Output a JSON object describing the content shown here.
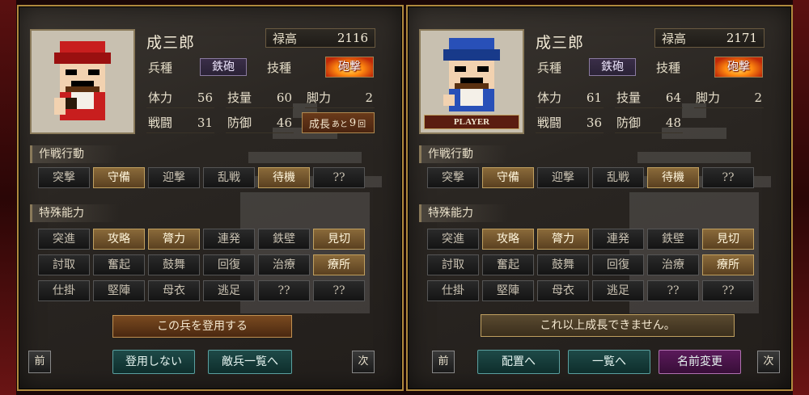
{
  "screens": [
    {
      "name": "成三郎",
      "income_label": "禄高",
      "income": "2116",
      "troop_label": "兵種",
      "troop": "鉄砲",
      "skill_label": "技種",
      "skill": "砲撃",
      "stats": [
        {
          "k": "体力",
          "v": "56"
        },
        {
          "k": "技量",
          "v": "60"
        },
        {
          "k": "脚力",
          "v": "2"
        },
        {
          "k": "戦闘",
          "v": "31"
        },
        {
          "k": "防御",
          "v": "46"
        }
      ],
      "growth": {
        "a": "成長",
        "b": "あと",
        "c": "9",
        "d": "回"
      },
      "player_tag": "",
      "tactics_title": "作戦行動",
      "tactics": [
        {
          "t": "突撃",
          "on": false
        },
        {
          "t": "守備",
          "on": true
        },
        {
          "t": "迎撃",
          "on": false
        },
        {
          "t": "乱戦",
          "on": false
        },
        {
          "t": "待機",
          "on": true
        },
        {
          "t": "??",
          "on": false
        }
      ],
      "special_title": "特殊能力",
      "special": [
        {
          "t": "突進",
          "on": false
        },
        {
          "t": "攻略",
          "on": true
        },
        {
          "t": "膂力",
          "on": true
        },
        {
          "t": "連発",
          "on": false
        },
        {
          "t": "鉄壁",
          "on": false
        },
        {
          "t": "見切",
          "on": true
        },
        {
          "t": "討取",
          "on": false
        },
        {
          "t": "奮起",
          "on": false
        },
        {
          "t": "鼓舞",
          "on": false
        },
        {
          "t": "回復",
          "on": false
        },
        {
          "t": "治療",
          "on": false
        },
        {
          "t": "療所",
          "on": true
        },
        {
          "t": "仕掛",
          "on": false
        },
        {
          "t": "堅陣",
          "on": false
        },
        {
          "t": "母衣",
          "on": false
        },
        {
          "t": "逃足",
          "on": false
        },
        {
          "t": "??",
          "on": false
        },
        {
          "t": "??",
          "on": false
        }
      ],
      "main_button": "この兵を登用する",
      "prev": "前",
      "next": "次",
      "actions": [
        "登用しない",
        "敵兵一覧へ"
      ],
      "sprite_color": "#c81e1e"
    },
    {
      "name": "成三郎",
      "income_label": "禄高",
      "income": "2171",
      "troop_label": "兵種",
      "troop": "鉄砲",
      "skill_label": "技種",
      "skill": "砲撃",
      "stats": [
        {
          "k": "体力",
          "v": "61"
        },
        {
          "k": "技量",
          "v": "64"
        },
        {
          "k": "脚力",
          "v": "2"
        },
        {
          "k": "戦闘",
          "v": "36"
        },
        {
          "k": "防御",
          "v": "48"
        }
      ],
      "player_tag": "PLAYER",
      "tactics_title": "作戦行動",
      "tactics": [
        {
          "t": "突撃",
          "on": false
        },
        {
          "t": "守備",
          "on": true
        },
        {
          "t": "迎撃",
          "on": false
        },
        {
          "t": "乱戦",
          "on": false
        },
        {
          "t": "待機",
          "on": true
        },
        {
          "t": "??",
          "on": false
        }
      ],
      "special_title": "特殊能力",
      "special": [
        {
          "t": "突進",
          "on": false
        },
        {
          "t": "攻略",
          "on": true
        },
        {
          "t": "膂力",
          "on": true
        },
        {
          "t": "連発",
          "on": false
        },
        {
          "t": "鉄壁",
          "on": false
        },
        {
          "t": "見切",
          "on": true
        },
        {
          "t": "討取",
          "on": false
        },
        {
          "t": "奮起",
          "on": false
        },
        {
          "t": "鼓舞",
          "on": false
        },
        {
          "t": "回復",
          "on": false
        },
        {
          "t": "治療",
          "on": false
        },
        {
          "t": "療所",
          "on": true
        },
        {
          "t": "仕掛",
          "on": false
        },
        {
          "t": "堅陣",
          "on": false
        },
        {
          "t": "母衣",
          "on": false
        },
        {
          "t": "逃足",
          "on": false
        },
        {
          "t": "??",
          "on": false
        },
        {
          "t": "??",
          "on": false
        }
      ],
      "main_button": "これ以上成長できません。",
      "prev": "前",
      "next": "次",
      "actions": [
        "配置へ",
        "一覧へ",
        "名前変更"
      ],
      "sprite_color": "#2850b8"
    }
  ]
}
